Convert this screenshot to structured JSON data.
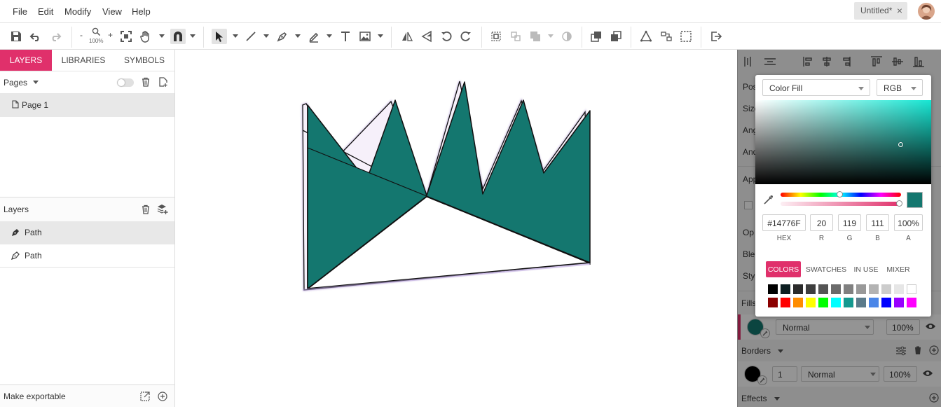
{
  "menu": [
    "File",
    "Edit",
    "Modify",
    "View",
    "Help"
  ],
  "document_tab": {
    "title": "Untitled*",
    "close": "×"
  },
  "toolbar": {
    "zoom_minus": "-",
    "zoom_plus": "+",
    "zoom_level": "100%"
  },
  "left_tabs": [
    "LAYERS",
    "LIBRARIES",
    "SYMBOLS"
  ],
  "pages": {
    "header": "Pages",
    "items": [
      "Page 1"
    ]
  },
  "layers": {
    "header": "Layers",
    "items": [
      "Path",
      "Path"
    ]
  },
  "make_exportable": "Make exportable",
  "right_panel": {
    "labels": [
      "Pos",
      "Size",
      "Ang",
      "And",
      "App",
      "Op",
      "Ble",
      "Sty"
    ],
    "fills": {
      "header": "Fills",
      "blend": "Normal",
      "opacity": "100%"
    },
    "borders": {
      "header": "Borders",
      "width": "1",
      "blend": "Normal",
      "opacity": "100%"
    },
    "effects": {
      "header": "Effects"
    }
  },
  "color_picker": {
    "fill_type": "Color Fill",
    "color_model": "RGB",
    "hex": "#14776F",
    "r": "20",
    "g": "119",
    "b": "111",
    "a": "100%",
    "labels": {
      "hex": "HEX",
      "r": "R",
      "g": "G",
      "b": "B",
      "a": "A"
    },
    "tabs": [
      "COLORS",
      "SWATCHES",
      "IN USE",
      "MIXER"
    ],
    "current_color": "#14776f",
    "hue_color": "#17e6d3",
    "swatches_row1": [
      "#000000",
      "#0d1f22",
      "#2b2b2b",
      "#3e3e3e",
      "#555555",
      "#6b6b6b",
      "#808080",
      "#999999",
      "#b3b3b3",
      "#cccccc",
      "#e6e6e6",
      "#ffffff"
    ],
    "swatches_row2": [
      "#8b0000",
      "#ff0000",
      "#ff8c00",
      "#ffff00",
      "#00ff00",
      "#00ffff",
      "#14998f",
      "#5b7b8b",
      "#4a86e8",
      "#0000ff",
      "#9900ff",
      "#ff00ff"
    ]
  },
  "colors": {
    "accent": "#e0306b",
    "shape_fill": "#14776f"
  }
}
